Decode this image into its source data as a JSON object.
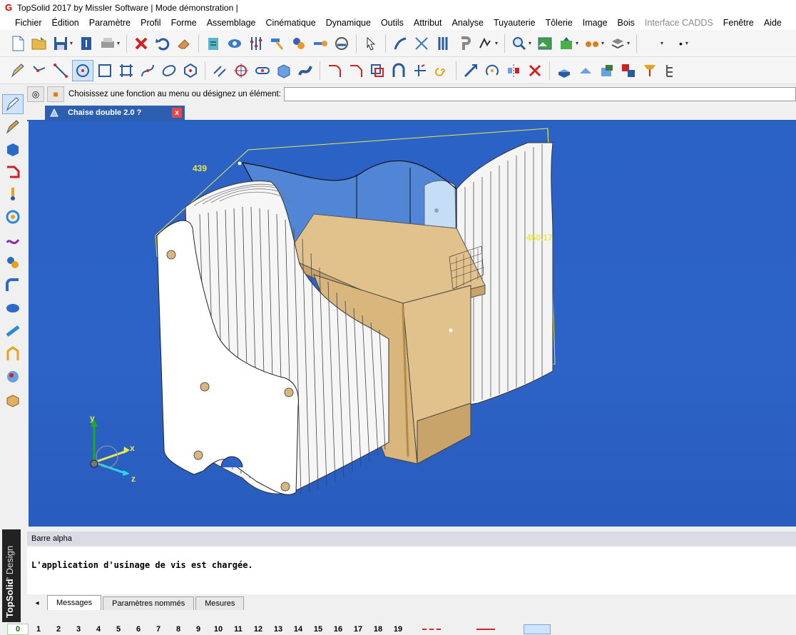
{
  "window": {
    "title": "TopSolid 2017 by Missler Software | Mode démonstration |"
  },
  "menu": [
    {
      "label": "Fichier",
      "enabled": true
    },
    {
      "label": "Édition",
      "enabled": true
    },
    {
      "label": "Paramètre",
      "enabled": true
    },
    {
      "label": "Profil",
      "enabled": true
    },
    {
      "label": "Forme",
      "enabled": true
    },
    {
      "label": "Assemblage",
      "enabled": true
    },
    {
      "label": "Cinématique",
      "enabled": true
    },
    {
      "label": "Dynamique",
      "enabled": true
    },
    {
      "label": "Outils",
      "enabled": true
    },
    {
      "label": "Attribut",
      "enabled": true
    },
    {
      "label": "Analyse",
      "enabled": true
    },
    {
      "label": "Tuyauterie",
      "enabled": true
    },
    {
      "label": "Tôlerie",
      "enabled": true
    },
    {
      "label": "Image",
      "enabled": true
    },
    {
      "label": "Bois",
      "enabled": true
    },
    {
      "label": "Interface CADDS",
      "enabled": false
    },
    {
      "label": "Fenêtre",
      "enabled": true
    },
    {
      "label": "Aide",
      "enabled": true
    }
  ],
  "prompt": {
    "text": "Choisissez une fonction au menu ou désignez un élément:",
    "value": ""
  },
  "document_tab": {
    "label": "Chaise double 2.0 ?"
  },
  "viewport": {
    "dimension_width": "439",
    "dimension_depth": "450.17",
    "axes": {
      "x": "x",
      "y": "y",
      "z": "z"
    },
    "colors": {
      "background": "#2b62c5",
      "wood": "#e2c28c",
      "panel": "#ffffff",
      "dimension": "#e8e84a"
    }
  },
  "alpha_bar": {
    "title": "Barre alpha",
    "message": "L'application d'usinage de vis est chargée."
  },
  "message_tabs": [
    "Messages",
    "Paramètres nommés",
    "Mesures"
  ],
  "brand": {
    "name": "TopSolid",
    "suffix": "' Design"
  },
  "layers": [
    "0",
    "1",
    "2",
    "3",
    "4",
    "5",
    "6",
    "7",
    "8",
    "9",
    "10",
    "11",
    "12",
    "13",
    "14",
    "15",
    "16",
    "17",
    "18",
    "19"
  ]
}
